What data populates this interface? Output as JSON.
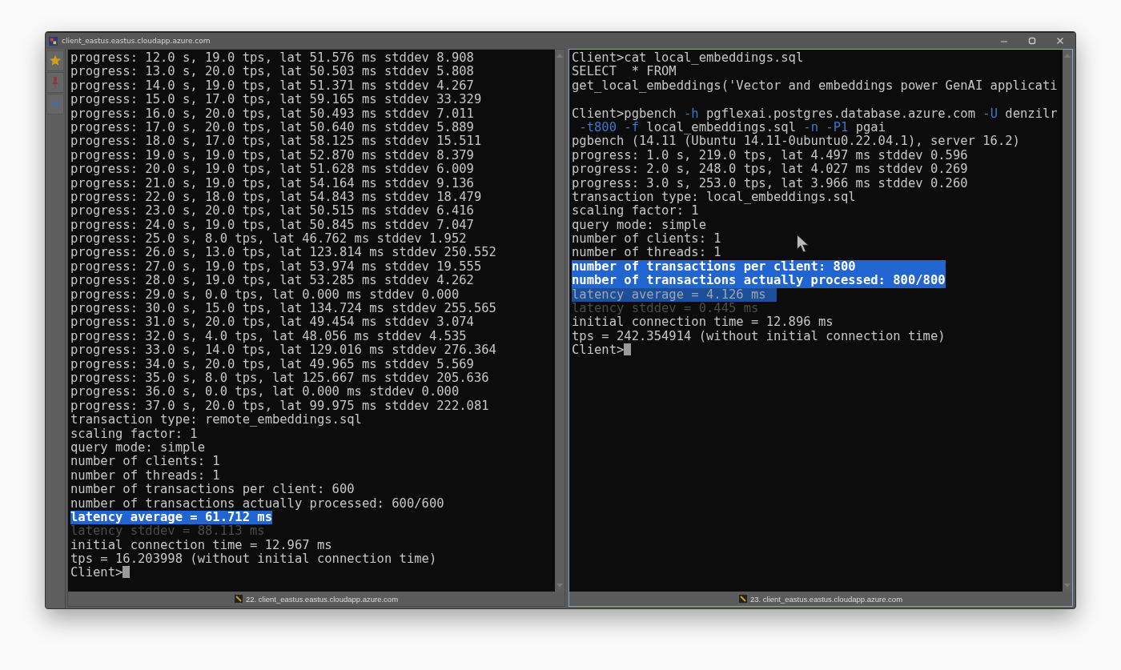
{
  "window": {
    "title": "client_eastus.eastus.cloudapp.azure.com"
  },
  "panes": [
    {
      "selected": false,
      "tab_label": "22. client_eastus.eastus.cloudapp.azure.com",
      "lines": [
        {
          "kind": "text",
          "text": "progress: 12.0 s, 19.0 tps, lat 51.576 ms stddev 8.908"
        },
        {
          "kind": "text",
          "text": "progress: 13.0 s, 20.0 tps, lat 50.503 ms stddev 5.808"
        },
        {
          "kind": "text",
          "text": "progress: 14.0 s, 19.0 tps, lat 51.371 ms stddev 4.267"
        },
        {
          "kind": "text",
          "text": "progress: 15.0 s, 17.0 tps, lat 59.165 ms stddev 33.329"
        },
        {
          "kind": "text",
          "text": "progress: 16.0 s, 20.0 tps, lat 50.493 ms stddev 7.011"
        },
        {
          "kind": "text",
          "text": "progress: 17.0 s, 20.0 tps, lat 50.640 ms stddev 5.889"
        },
        {
          "kind": "text",
          "text": "progress: 18.0 s, 17.0 tps, lat 58.125 ms stddev 15.511"
        },
        {
          "kind": "text",
          "text": "progress: 19.0 s, 19.0 tps, lat 52.870 ms stddev 8.379"
        },
        {
          "kind": "text",
          "text": "progress: 20.0 s, 19.0 tps, lat 51.628 ms stddev 6.009"
        },
        {
          "kind": "text",
          "text": "progress: 21.0 s, 19.0 tps, lat 54.164 ms stddev 9.136"
        },
        {
          "kind": "text",
          "text": "progress: 22.0 s, 18.0 tps, lat 54.843 ms stddev 18.479"
        },
        {
          "kind": "text",
          "text": "progress: 23.0 s, 20.0 tps, lat 50.515 ms stddev 6.416"
        },
        {
          "kind": "text",
          "text": "progress: 24.0 s, 19.0 tps, lat 50.845 ms stddev 7.047"
        },
        {
          "kind": "text",
          "text": "progress: 25.0 s, 8.0 tps, lat 46.762 ms stddev 1.952"
        },
        {
          "kind": "text",
          "text": "progress: 26.0 s, 13.0 tps, lat 123.814 ms stddev 250.552"
        },
        {
          "kind": "text",
          "text": "progress: 27.0 s, 19.0 tps, lat 53.974 ms stddev 19.555"
        },
        {
          "kind": "text",
          "text": "progress: 28.0 s, 19.0 tps, lat 53.285 ms stddev 4.262"
        },
        {
          "kind": "text",
          "text": "progress: 29.0 s, 0.0 tps, lat 0.000 ms stddev 0.000"
        },
        {
          "kind": "text",
          "text": "progress: 30.0 s, 15.0 tps, lat 134.724 ms stddev 255.565"
        },
        {
          "kind": "text",
          "text": "progress: 31.0 s, 20.0 tps, lat 49.454 ms stddev 3.074"
        },
        {
          "kind": "text",
          "text": "progress: 32.0 s, 4.0 tps, lat 48.056 ms stddev 4.535"
        },
        {
          "kind": "text",
          "text": "progress: 33.0 s, 14.0 tps, lat 129.016 ms stddev 276.364"
        },
        {
          "kind": "text",
          "text": "progress: 34.0 s, 20.0 tps, lat 49.965 ms stddev 5.569"
        },
        {
          "kind": "text",
          "text": "progress: 35.0 s, 8.0 tps, lat 125.667 ms stddev 205.636"
        },
        {
          "kind": "text",
          "text": "progress: 36.0 s, 0.0 tps, lat 0.000 ms stddev 0.000"
        },
        {
          "kind": "text",
          "text": "progress: 37.0 s, 20.0 tps, lat 99.975 ms stddev 222.081"
        },
        {
          "kind": "text",
          "text": "transaction type: remote_embeddings.sql"
        },
        {
          "kind": "text",
          "text": "scaling factor: 1"
        },
        {
          "kind": "text",
          "text": "query mode: simple"
        },
        {
          "kind": "text",
          "text": "number of clients: 1"
        },
        {
          "kind": "text",
          "text": "number of threads: 1"
        },
        {
          "kind": "text",
          "text": "number of transactions per client: 600"
        },
        {
          "kind": "text",
          "text": "number of transactions actually processed: 600/600"
        },
        {
          "kind": "selected",
          "text": "latency average = 61.712 ms"
        },
        {
          "kind": "faded",
          "text": "latency stddev = 88.113 ms"
        },
        {
          "kind": "text",
          "text": "initial connection time = 12.967 ms"
        },
        {
          "kind": "text",
          "text": "tps = 16.203998 (without initial connection time)"
        },
        {
          "kind": "prompt",
          "text": "Client>"
        }
      ]
    },
    {
      "selected": true,
      "tab_label": "23. client_eastus.eastus.cloudapp.azure.com",
      "lines": [
        {
          "kind": "text",
          "text": "Client>cat local_embeddings.sql"
        },
        {
          "kind": "text",
          "text": "SELECT  * FROM"
        },
        {
          "kind": "text",
          "text": "get_local_embeddings('Vector and embeddings power GenAI applicati"
        },
        {
          "kind": "blank"
        },
        {
          "kind": "command",
          "parts": [
            {
              "text": "Client>pgbench",
              "option": false
            },
            {
              "text": "-h",
              "option": true
            },
            {
              "text": "pgflexai.postgres.database.azure.com",
              "option": false
            },
            {
              "text": "-U",
              "option": true
            },
            {
              "text": "denzilr",
              "option": false
            }
          ]
        },
        {
          "kind": "command",
          "parts": [
            {
              "text": " -t800",
              "option": true
            },
            {
              "text": "-f",
              "option": true
            },
            {
              "text": "local_embeddings.sql",
              "option": false
            },
            {
              "text": "-n",
              "option": true
            },
            {
              "text": "-P1",
              "option": true
            },
            {
              "text": "pgai",
              "option": false
            }
          ]
        },
        {
          "kind": "text",
          "text": "pgbench (14.11 (Ubuntu 14.11-0ubuntu0.22.04.1), server 16.2)"
        },
        {
          "kind": "text",
          "text": "progress: 1.0 s, 219.0 tps, lat 4.497 ms stddev 0.596"
        },
        {
          "kind": "text",
          "text": "progress: 2.0 s, 248.0 tps, lat 4.027 ms stddev 0.269"
        },
        {
          "kind": "text",
          "text": "progress: 3.0 s, 253.0 tps, lat 3.966 ms stddev 0.260"
        },
        {
          "kind": "text",
          "text": "transaction type: local_embeddings.sql"
        },
        {
          "kind": "text",
          "text": "scaling factor: 1"
        },
        {
          "kind": "text",
          "text": "query mode: simple"
        },
        {
          "kind": "text",
          "text": "number of clients: 1"
        },
        {
          "kind": "text",
          "text": "number of threads: 1"
        },
        {
          "kind": "selected",
          "text": "number of transactions per client: 800"
        },
        {
          "kind": "selected",
          "text": "number of transactions actually processed: 800/800"
        },
        {
          "kind": "selected_dim",
          "text": "latency average = 4.126 ms"
        },
        {
          "kind": "faded",
          "text": "latency stddev = 0.445 ms"
        },
        {
          "kind": "text",
          "text": "initial connection time = 12.896 ms"
        },
        {
          "kind": "text",
          "text": "tps = 242.354914 (without initial connection time)"
        },
        {
          "kind": "prompt",
          "text": "Client>"
        }
      ]
    }
  ]
}
